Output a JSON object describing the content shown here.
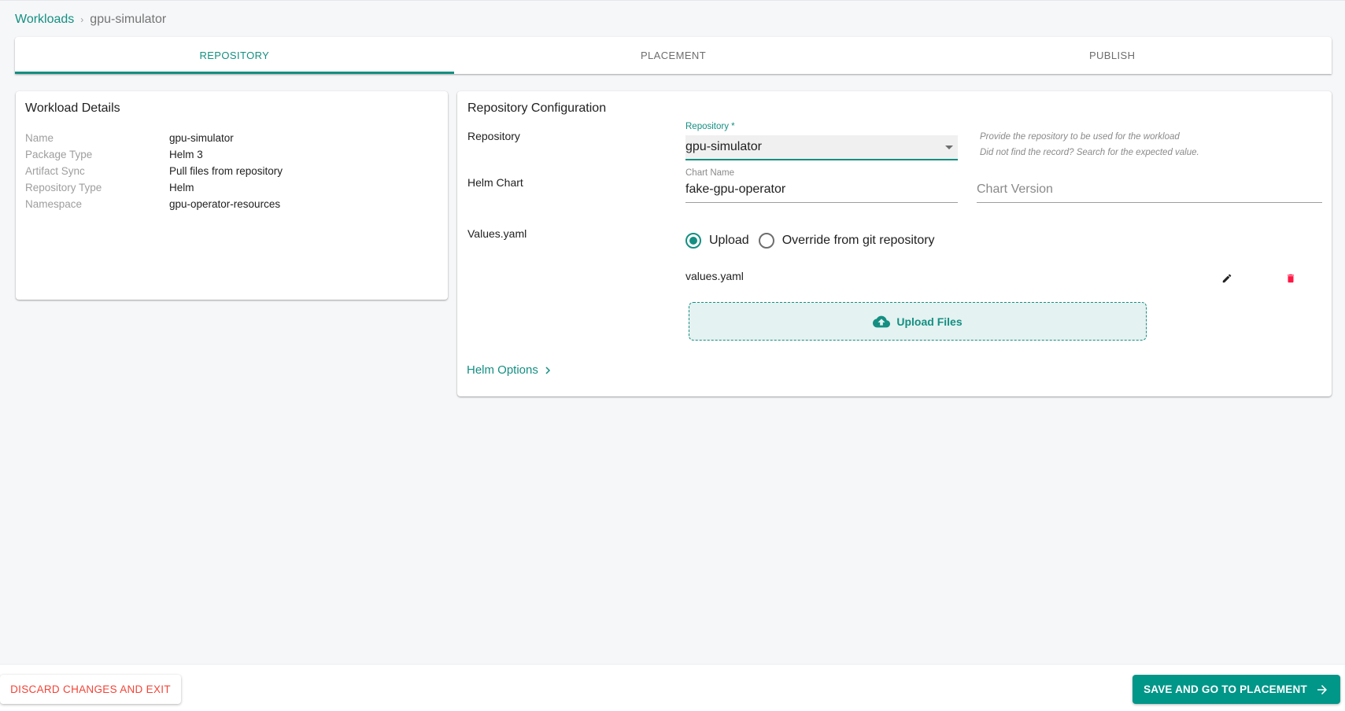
{
  "breadcrumb": {
    "parent": "Workloads",
    "separator": "›",
    "current": "gpu-simulator"
  },
  "tabs": [
    {
      "label": "REPOSITORY",
      "active": true
    },
    {
      "label": "PLACEMENT",
      "active": false
    },
    {
      "label": "PUBLISH",
      "active": false
    }
  ],
  "workload_details": {
    "title": "Workload Details",
    "rows": [
      {
        "label": "Name",
        "value": "gpu-simulator"
      },
      {
        "label": "Package Type",
        "value": "Helm 3"
      },
      {
        "label": "Artifact Sync",
        "value": "Pull files from repository"
      },
      {
        "label": "Repository Type",
        "value": "Helm"
      },
      {
        "label": "Namespace",
        "value": "gpu-operator-resources"
      }
    ]
  },
  "repo_config": {
    "title": "Repository Configuration",
    "repository": {
      "section_label": "Repository",
      "field_label": "Repository *",
      "value": "gpu-simulator",
      "hint_1": "Provide the repository to be used for the workload",
      "hint_2": "Did not find the record? Search for the expected value."
    },
    "helm_chart": {
      "section_label": "Helm Chart",
      "chart_name_label": "Chart Name",
      "chart_name_value": "fake-gpu-operator",
      "chart_version_placeholder": "Chart Version"
    },
    "values_yaml": {
      "section_label": "Values.yaml",
      "options": [
        {
          "label": "Upload",
          "checked": true
        },
        {
          "label": "Override from git repository",
          "checked": false
        }
      ],
      "file_name": "values.yaml",
      "upload_label": "Upload Files"
    },
    "helm_options_label": "Helm Options"
  },
  "footer": {
    "discard_label": "DISCARD CHANGES AND EXIT",
    "save_label": "SAVE AND GO TO PLACEMENT"
  },
  "colors": {
    "accent": "#148f82",
    "primary_button": "#009688",
    "danger": "#f44336",
    "delete_icon": "#ff1744"
  }
}
